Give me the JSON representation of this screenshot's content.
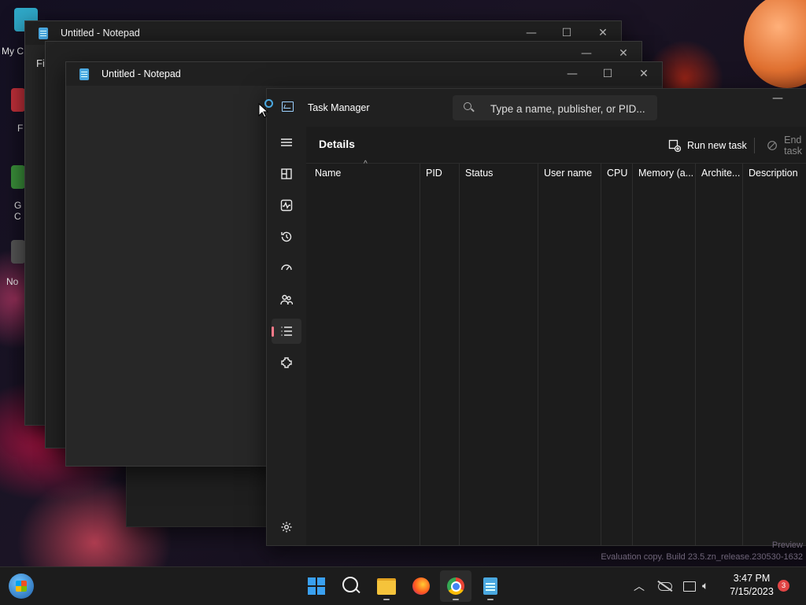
{
  "desktop": {
    "icons": [
      {
        "label": "My C"
      },
      {
        "label": "F"
      },
      {
        "label": "G\nC"
      },
      {
        "label": "No"
      }
    ],
    "watermark": [
      "Preview",
      "Evaluation copy. Build 23.5.zn_release.230530-1632"
    ]
  },
  "notepad_back": {
    "title": "Untitled - Notepad",
    "menu_first": "Fi"
  },
  "notepad_front": {
    "title": "Untitled - Notepad"
  },
  "window_controls": {
    "minimize": "—",
    "maximize": "☐",
    "close": "✕"
  },
  "task_manager": {
    "app_title": "Task Manager",
    "search_placeholder": "Type a name, publisher, or PID...",
    "page_title": "Details",
    "commands": {
      "run_new_task": "Run new task",
      "end_task": "End task"
    },
    "columns": [
      {
        "label": "Name"
      },
      {
        "label": "PID"
      },
      {
        "label": "Status"
      },
      {
        "label": "User name"
      },
      {
        "label": "CPU"
      },
      {
        "label": "Memory (a..."
      },
      {
        "label": "Archite..."
      },
      {
        "label": "Description"
      }
    ],
    "nav": [
      {
        "name": "hamburger-menu-icon"
      },
      {
        "name": "processes-icon"
      },
      {
        "name": "performance-icon"
      },
      {
        "name": "app-history-icon"
      },
      {
        "name": "startup-apps-icon"
      },
      {
        "name": "users-icon"
      },
      {
        "name": "details-icon",
        "active": true
      },
      {
        "name": "services-icon"
      },
      {
        "name": "settings-icon"
      }
    ]
  },
  "taskbar": {
    "time": "3:47 PM",
    "date": "7/15/2023",
    "notification_count": "3",
    "apps": [
      "start-icon",
      "task-view-icon",
      "search-icon",
      "file-explorer-icon",
      "firefox-icon",
      "chrome-icon",
      "notepad-icon"
    ]
  }
}
